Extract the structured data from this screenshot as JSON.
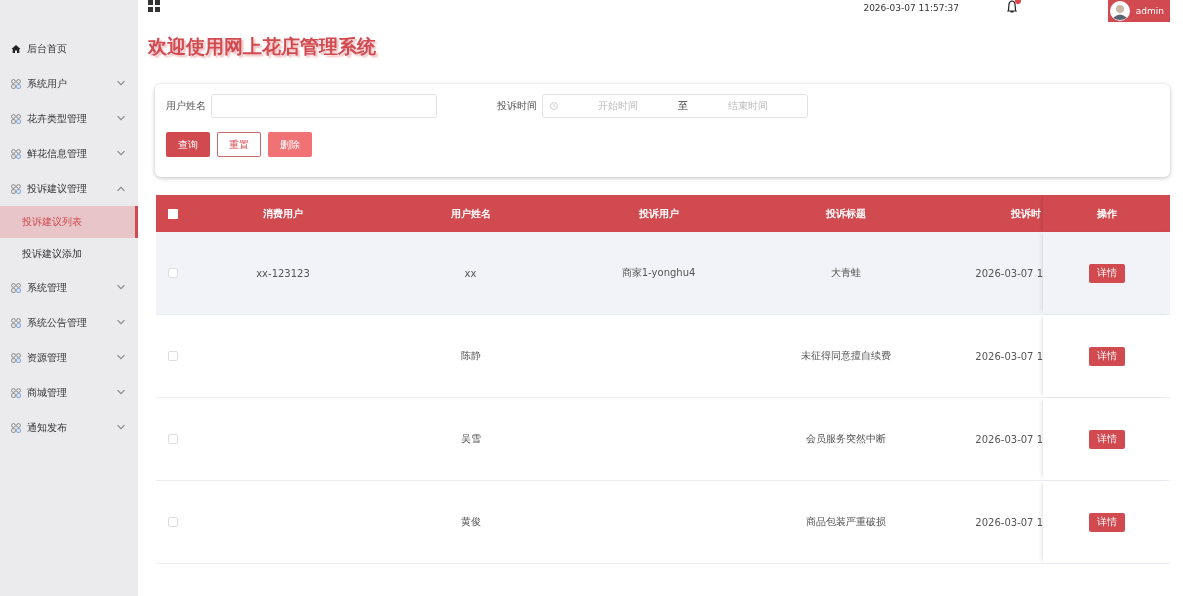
{
  "header": {
    "datetime": "2026-03-07 11:57:37",
    "user": "admin"
  },
  "sidebar": {
    "items": [
      {
        "label": "后台首页",
        "kind": "home"
      },
      {
        "label": "系统用户",
        "kind": "menu",
        "expanded": false
      },
      {
        "label": "花卉类型管理",
        "kind": "menu",
        "expanded": false
      },
      {
        "label": "鲜花信息管理",
        "kind": "menu",
        "expanded": false
      },
      {
        "label": "投诉建议管理",
        "kind": "menu",
        "expanded": true,
        "children": [
          {
            "label": "投诉建议列表",
            "selected": true
          },
          {
            "label": "投诉建议添加",
            "selected": false
          }
        ]
      },
      {
        "label": "系统管理",
        "kind": "menu",
        "expanded": false
      },
      {
        "label": "系统公告管理",
        "kind": "menu",
        "expanded": false
      },
      {
        "label": "资源管理",
        "kind": "menu",
        "expanded": false
      },
      {
        "label": "商城管理",
        "kind": "menu",
        "expanded": false
      },
      {
        "label": "通知发布",
        "kind": "menu",
        "expanded": false
      }
    ]
  },
  "page_title": "欢迎使用网上花店管理系统",
  "search": {
    "name_label": "用户姓名",
    "time_label": "投诉时间",
    "start_placeholder": "开始时间",
    "range_separator": "至",
    "end_placeholder": "结束时间",
    "buttons": [
      {
        "label": "查询",
        "kind": "primary"
      },
      {
        "label": "重置",
        "kind": "outline"
      },
      {
        "label": "删除",
        "kind": "danger"
      }
    ]
  },
  "table": {
    "select_all_checked": false,
    "columns": [
      "消费用户",
      "用户姓名",
      "投诉用户",
      "投诉标题",
      "投诉时"
    ],
    "action_column": "操作",
    "rows": [
      {
        "cells": [
          "xx-123123",
          "xx",
          "商家1-yonghu4",
          "大青蛙",
          "2026-03-07 1"
        ],
        "action": "详情",
        "checked": false,
        "highlighted": true
      },
      {
        "cells": [
          "",
          "陈静",
          "",
          "未征得同意擅自续费",
          "2026-03-07 1"
        ],
        "action": "详情",
        "checked": false,
        "highlighted": false
      },
      {
        "cells": [
          "",
          "吴雪",
          "",
          "会员服务突然中断",
          "2026-03-07 1"
        ],
        "action": "详情",
        "checked": false,
        "highlighted": false
      },
      {
        "cells": [
          "",
          "黄俊",
          "",
          "商品包装严重破损",
          "2026-03-07 1"
        ],
        "action": "详情",
        "checked": false,
        "highlighted": false
      }
    ]
  }
}
